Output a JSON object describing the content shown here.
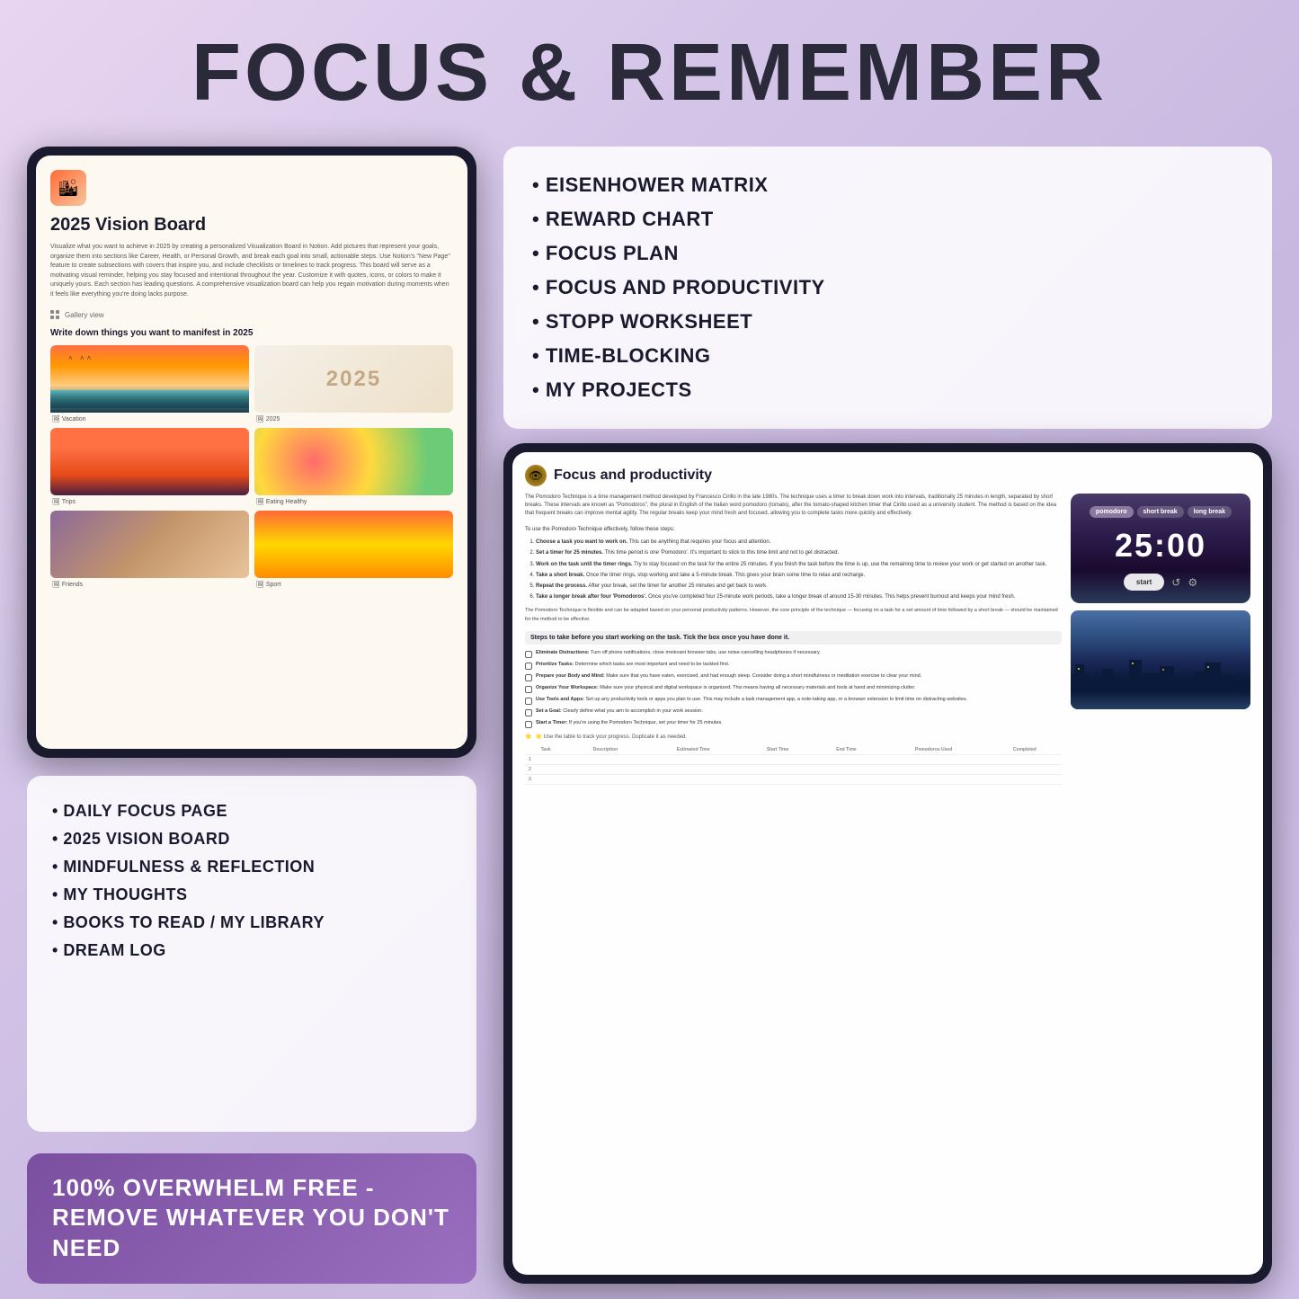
{
  "page": {
    "title": "FOCUS & REMEMBER",
    "background": "gradient purple"
  },
  "left_tablet": {
    "icon_emoji": "🏙",
    "title": "2025 Vision Board",
    "description": "Visualize what you want to achieve in 2025 by creating a personalized Visualization Board in Notion. Add pictures that represent your goals, organize them into sections like Career, Health, or Personal Growth, and break each goal into small, actionable steps. Use Notion's \"New Page\" feature to create subsections with covers that inspire you, and include checklists or timelines to track progress. This board will serve as a motivating visual reminder, helping you stay focused and intentional throughout the year. Customize it with quotes, icons, or colors to make it uniquely yours. Each section has leading questions. A comprehensive visualization board can help you regain motivation during moments when it feels like everything you're doing lacks purpose.",
    "gallery_view_label": "Gallery view",
    "manifest_heading": "Write down things you want to manifest in 2025",
    "gallery_items": [
      {
        "label": "Vacation",
        "type": "vacation"
      },
      {
        "label": "2025",
        "type": "2025"
      },
      {
        "label": "Trips",
        "type": "trips"
      },
      {
        "label": "Eating Healthy",
        "type": "eating"
      },
      {
        "label": "Friends",
        "type": "friends"
      },
      {
        "label": "Sport",
        "type": "sport"
      }
    ]
  },
  "left_bullets": {
    "items": [
      "DAILY FOCUS PAGE",
      "2025 VISION BOARD",
      "MINDFULNESS & REFLECTION",
      "MY THOUGHTS",
      "BOOKS TO READ / MY LIBRARY",
      "DREAM LOG"
    ]
  },
  "bottom_banner": {
    "text": "100% OVERWHELM FREE - REMOVE WHATEVER YOU DON'T NEED"
  },
  "right_bullets": {
    "items": [
      "EISENHOWER MATRIX",
      "REWARD CHART",
      "FOCUS PLAN",
      "FOCUS AND PRODUCTIVITY",
      "STOPP WORKSHEET",
      "TIME-BLOCKING",
      "MY PROJECTS"
    ]
  },
  "right_tablet": {
    "icon": "👁",
    "title": "Focus and productivity",
    "description": "The Pomodoro Technique is a time management method developed by Francesco Cirillo in the late 1980s. The technique uses a timer to break down work into intervals, traditionally 25 minutes in length, separated by short breaks. These intervals are known as \"Pomodoros\", the plural in English of the Italian word pomodoro (tomato), after the tomato-shaped kitchen timer that Cirillo used as a university student. The method is based on the idea that frequent breaks can improve mental agility. The regular breaks keep your mind fresh and focused, allowing you to complete tasks more quickly and effectively.",
    "intro": "To use the Pomodoro Technique effectively, follow these steps:",
    "steps": [
      {
        "num": 1,
        "bold": "Choose a task you want to work on.",
        "text": "This can be anything that requires your focus and attention."
      },
      {
        "num": 2,
        "bold": "Set a timer for 25 minutes.",
        "text": "This time period is one 'Pomodoro'. It's important to stick to this time limit and not to get distracted."
      },
      {
        "num": 3,
        "bold": "Work on the task until the timer rings.",
        "text": "Try to stay focused on the task for the entire 25 minutes. If you finish the task before the time is up, use the remaining time to review your work or get started on another task."
      },
      {
        "num": 4,
        "bold": "Take a short break.",
        "text": "Once the timer rings, stop working and take a 5-minute break. This gives your brain some time to relax and recharge."
      },
      {
        "num": 5,
        "bold": "Repeat the process.",
        "text": "After your break, set the timer for another 25 minutes and get back to work."
      },
      {
        "num": 6,
        "bold": "Take a longer break after four 'Pomodoros'.",
        "text": "Once you've completed four 25-minute work periods, take a longer break of around 15-30 minutes. This helps prevent burnout and keeps your mind fresh."
      }
    ],
    "flexible_note": "The Pomodoro Technique is flexible and can be adapted based on your personal productivity patterns. However, the core principle of the technique — focusing on a task for a set amount of time followed by a short break — should be maintained for the method to be effective.",
    "timer": {
      "tabs": [
        "pomodoro",
        "short break",
        "long break"
      ],
      "active_tab": "pomodoro",
      "time": "25:00",
      "start_button": "start",
      "icons": [
        "↺",
        "⚙"
      ]
    },
    "steps_heading": "Steps to take before you start working on the task. Tick the box once you have done it.",
    "checklist": [
      {
        "label": "Eliminate Distractions:",
        "text": "Turn off phone notifications, close irrelevant browser tabs, use noise-cancelling headphones if necessary."
      },
      {
        "label": "Prioritize Tasks:",
        "text": "Determine which tasks are most important and need to be tackled first."
      },
      {
        "label": "Prepare your Body and Mind:",
        "text": "Make sure that you have eaten, exercised, and had enough sleep. Consider doing a short mindfulness or meditation exercise to clear your mind."
      },
      {
        "label": "Organize Your Workspace:",
        "text": "Make sure your physical and digital workspace is organized. This means having all necessary materials and tools at hand and minimizing clutter."
      },
      {
        "label": "Use Tools and Apps:",
        "text": "Set up any productivity tools or apps you plan to use. This may include a task management app, a note-taking app, or a browser extension to limit time on distracting websites."
      },
      {
        "label": "Set a Goal:",
        "text": "Clearly define what you aim to accomplish in your work session."
      },
      {
        "label": "Start a Timer:",
        "text": "If you're using the Pomodoro Technique, set your timer for 25 minutes."
      }
    ],
    "table_note": "🌟 Use the table to track your progress. Duplicate it as needed.",
    "table_headers": [
      "Task",
      "Description",
      "Estimated Time",
      "Start Time",
      "End Time",
      "Pomodoros Used",
      "Completed"
    ],
    "table_rows": [
      "1",
      "2",
      "3"
    ]
  }
}
